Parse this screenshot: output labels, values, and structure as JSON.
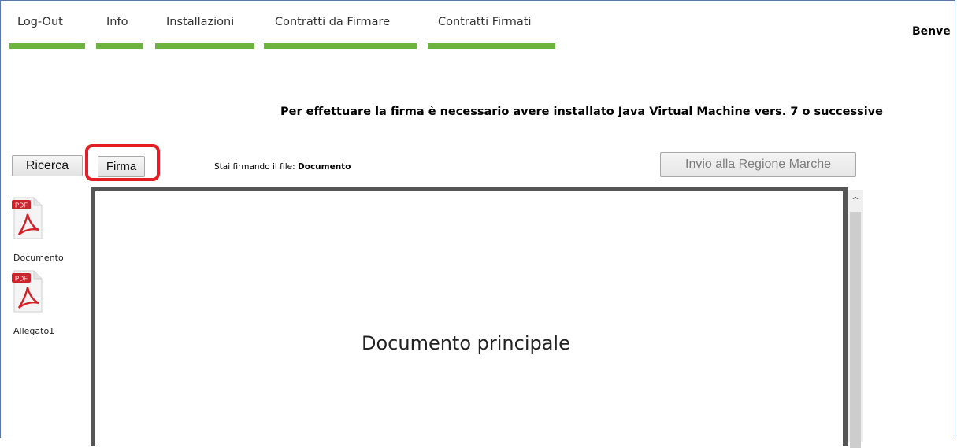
{
  "nav": {
    "items": [
      {
        "label": "Log-Out"
      },
      {
        "label": "Info"
      },
      {
        "label": "Installazioni"
      },
      {
        "label": "Contratti da Firmare"
      },
      {
        "label": "Contratti Firmati"
      }
    ],
    "accent_color": "#6db33f"
  },
  "header": {
    "welcome": "Benve"
  },
  "notice": "Per effettuare la firma è necessario avere installato Java Virtual Machine vers. 7 o successive",
  "toolbar": {
    "search_label": "Ricerca",
    "sign_label": "Firma",
    "status_prefix": "Stai firmando il file:",
    "status_file": "Documento",
    "send_label": "Invio alla Regione Marche"
  },
  "files": [
    {
      "name": "Documento",
      "icon": "pdf-file-icon",
      "badge": "PDF"
    },
    {
      "name": "Allegato1",
      "icon": "pdf-file-icon",
      "badge": "PDF"
    }
  ],
  "viewer": {
    "content_title": "Documento principale"
  },
  "highlight_color": "#e31e24"
}
